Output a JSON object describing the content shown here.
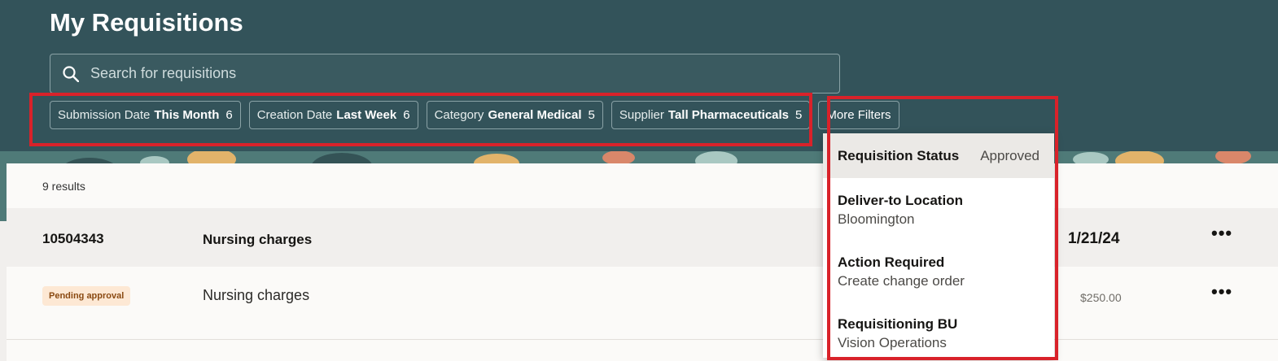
{
  "page": {
    "title": "My Requisitions"
  },
  "search": {
    "placeholder": "Search for requisitions"
  },
  "filters": [
    {
      "label": "Submission Date",
      "value": "This Month",
      "count": "6"
    },
    {
      "label": "Creation Date",
      "value": "Last Week",
      "count": "6"
    },
    {
      "label": "Category",
      "value": "General Medical",
      "count": "5"
    },
    {
      "label": "Supplier",
      "value": "Tall Pharmaceuticals",
      "count": "5"
    }
  ],
  "more_filters": {
    "label": "More Filters",
    "items": [
      {
        "label": "Requisition Status",
        "value": "Approved"
      },
      {
        "label": "Deliver-to Location",
        "value": "Bloomington"
      },
      {
        "label": "Action Required",
        "value": "Create change order"
      },
      {
        "label": "Requisitioning BU",
        "value": "Vision Operations"
      }
    ]
  },
  "results": {
    "count_text": "9 results",
    "requisition": {
      "number": "10504343",
      "description": "Nursing charges",
      "date": "1/21/24",
      "actions_label": "•••"
    },
    "line": {
      "status": "Pending approval",
      "description": "Nursing charges",
      "amount": "$250.00",
      "actions_label": "•••"
    }
  },
  "colors": {
    "header_bg": "#33535a",
    "highlight": "#d9222a",
    "badge_bg": "#fde8d4",
    "badge_text": "#8a4a12"
  }
}
